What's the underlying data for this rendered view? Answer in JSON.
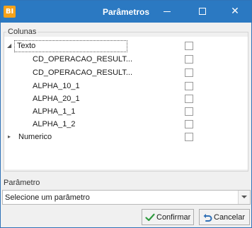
{
  "window": {
    "logo_text": "BI",
    "title": "Parâmetros",
    "minimize_glyph": "",
    "maximize_glyph": "",
    "close_glyph": "✕"
  },
  "colunas": {
    "legend": "Colunas",
    "tree": [
      {
        "label": "Texto",
        "level": 0,
        "expanded": true,
        "selected": true,
        "checked": false
      },
      {
        "label": "CD_OPERACAO_RESULT...",
        "level": 1,
        "checked": false
      },
      {
        "label": "CD_OPERACAO_RESULT...",
        "level": 1,
        "checked": false
      },
      {
        "label": "ALPHA_10_1",
        "level": 1,
        "checked": false
      },
      {
        "label": "ALPHA_20_1",
        "level": 1,
        "checked": false
      },
      {
        "label": "ALPHA_1_1",
        "level": 1,
        "checked": false
      },
      {
        "label": "ALPHA_1_2",
        "level": 1,
        "checked": false
      },
      {
        "label": "Numerico",
        "level": 0,
        "expanded": false,
        "checked": false
      }
    ]
  },
  "parametro": {
    "label": "Parâmetro",
    "selected_value": "Selecione um parâmetro"
  },
  "buttons": {
    "confirm_label": "Confirmar",
    "cancel_label": "Cancelar"
  },
  "colors": {
    "titlebar": "#2b79c2",
    "logo": "#f6a21a",
    "confirm_icon": "#2e9a3e",
    "cancel_icon": "#2f6fb5"
  },
  "icons": {
    "expanded": "expanded-triangle-icon",
    "collapsed": "collapsed-triangle-icon",
    "confirm": "checkmark-icon",
    "cancel": "undo-arrow-icon",
    "dropdown": "chevron-down-icon"
  }
}
